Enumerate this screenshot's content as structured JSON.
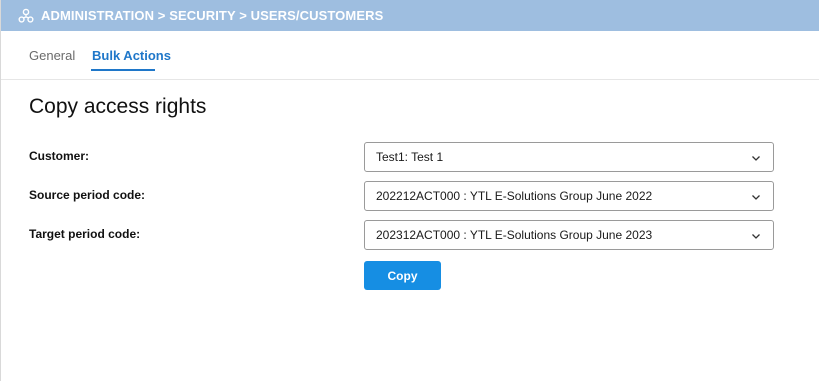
{
  "header": {
    "breadcrumb": "ADMINISTRATION > SECURITY > USERS/CUSTOMERS",
    "logo_icon": "users-network-icon",
    "background": "#9ebee0"
  },
  "tabs": [
    {
      "label": "General",
      "active": false
    },
    {
      "label": "Bulk Actions",
      "active": true
    }
  ],
  "form": {
    "title": "Copy access rights",
    "fields": [
      {
        "label": "Customer:",
        "value": "Test1: Test 1"
      },
      {
        "label": "Source period code:",
        "value": "202212ACT000 : YTL E-Solutions Group June 2022"
      },
      {
        "label": "Target period code:",
        "value": "202312ACT000 : YTL E-Solutions Group June 2023"
      }
    ],
    "copy_label": "Copy",
    "accent": "#168ee3"
  }
}
